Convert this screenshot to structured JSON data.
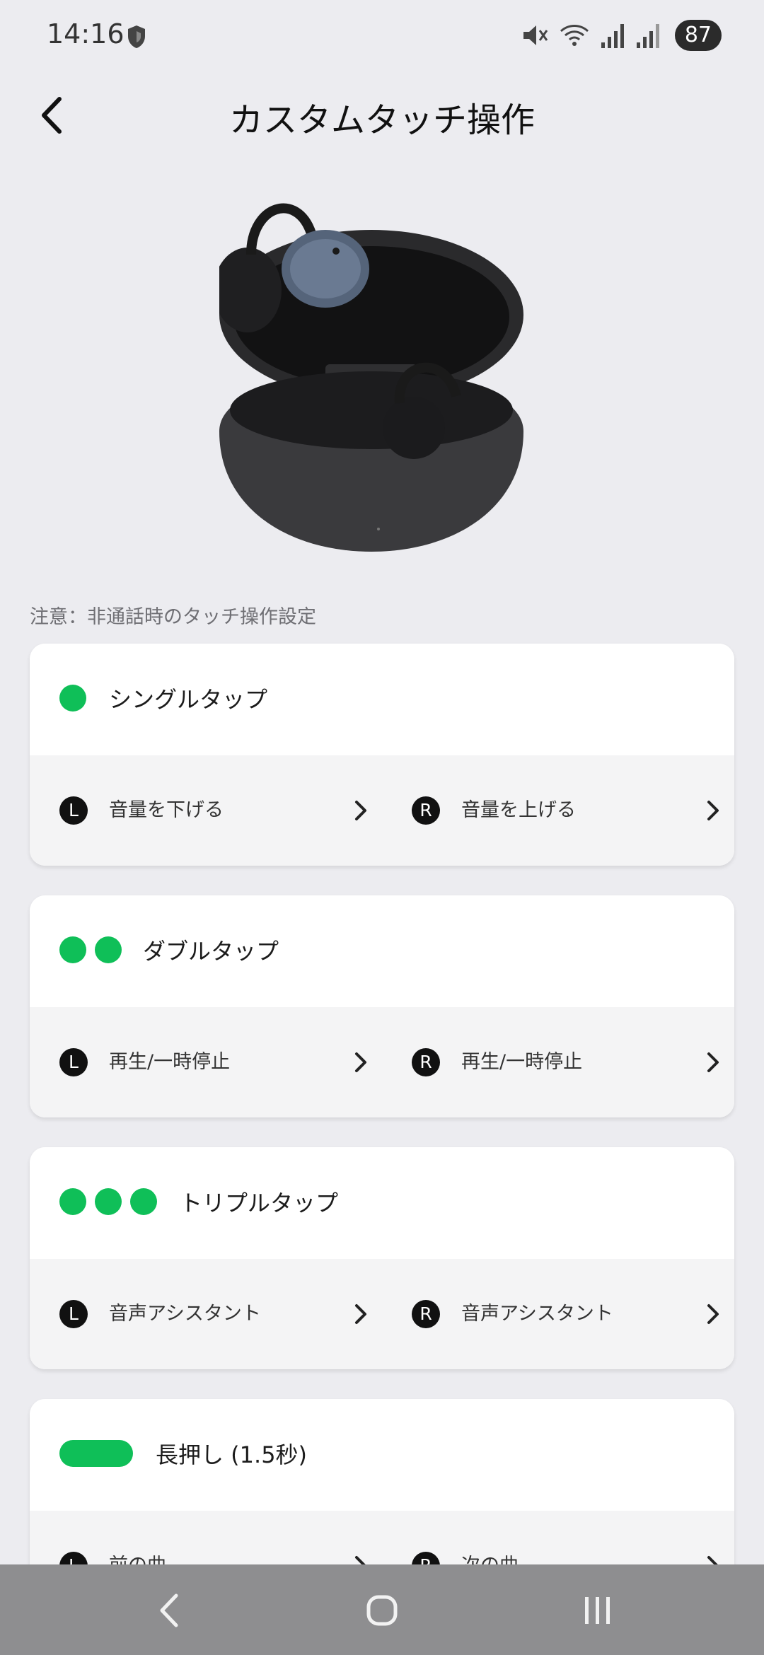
{
  "status_bar": {
    "time": "14:16",
    "battery": "87"
  },
  "header": {
    "title": "カスタムタッチ操作"
  },
  "note": "注意：非通話時のタッチ操作設定",
  "gestures": [
    {
      "title": "シングルタップ",
      "left_badge": "L",
      "left_action": "音量を下げる",
      "right_badge": "R",
      "right_action": "音量を上げる"
    },
    {
      "title": "ダブルタップ",
      "left_badge": "L",
      "left_action": "再生/一時停止",
      "right_badge": "R",
      "right_action": "再生/一時停止"
    },
    {
      "title": "トリプルタップ",
      "left_badge": "L",
      "left_action": "音声アシスタント",
      "right_badge": "R",
      "right_action": "音声アシスタント"
    },
    {
      "title": "長押し (1.5秒)",
      "left_badge": "L",
      "left_action": "前の曲",
      "right_badge": "R",
      "right_action": "次の曲"
    }
  ],
  "colors": {
    "accent": "#0fbf58",
    "background": "#ececf0",
    "nav_bar": "#8e8e90"
  },
  "icons": [
    "back-icon",
    "shield-icon",
    "mute-icon",
    "wifi-icon",
    "signal-icon",
    "chevron-right-icon",
    "nav-back-icon",
    "nav-home-icon",
    "nav-recents-icon"
  ]
}
